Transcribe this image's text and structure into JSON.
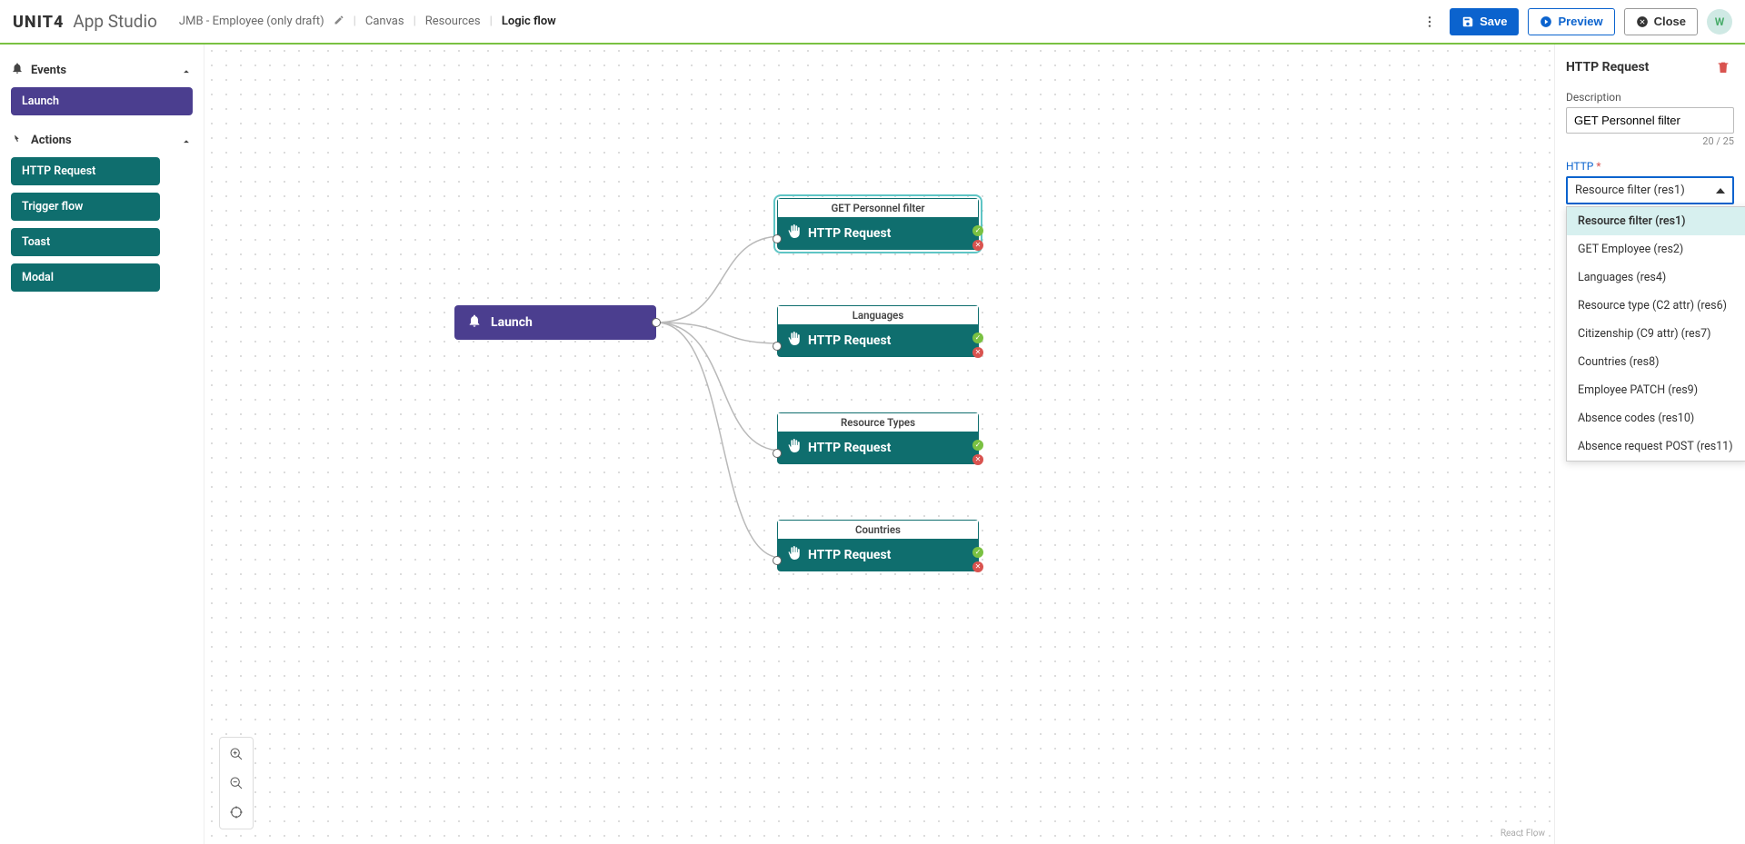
{
  "brand": {
    "logo": "UNIT4",
    "product": "App Studio"
  },
  "breadcrumbs": {
    "project": "JMB - Employee (only draft)",
    "items": [
      "Canvas",
      "Resources",
      "Logic flow"
    ],
    "active_index": 2
  },
  "top_actions": {
    "save": "Save",
    "preview": "Preview",
    "close": "Close",
    "avatar_initial": "W"
  },
  "sidebar": {
    "events_label": "Events",
    "actions_label": "Actions",
    "events": [
      {
        "label": "Launch"
      }
    ],
    "actions": [
      {
        "label": "HTTP Request"
      },
      {
        "label": "Trigger flow"
      },
      {
        "label": "Toast"
      },
      {
        "label": "Modal"
      }
    ]
  },
  "canvas": {
    "launch_label": "Launch",
    "http_label": "HTTP Request",
    "nodes": [
      {
        "title": "GET Personnel filter",
        "selected": true
      },
      {
        "title": "Languages",
        "selected": false
      },
      {
        "title": "Resource Types",
        "selected": false
      },
      {
        "title": "Countries",
        "selected": false
      }
    ],
    "attribution": "React Flow"
  },
  "rightpanel": {
    "title": "HTTP Request",
    "desc_label": "Description",
    "desc_value": "GET Personnel filter",
    "desc_counter": "20 / 25",
    "http_label": "HTTP",
    "http_selected": "Resource filter (res1)",
    "http_options": [
      "Resource filter (res1)",
      "GET Employee (res2)",
      "Languages (res4)",
      "Resource type (C2 attr) (res6)",
      "Citizenship (C9 attr) (res7)",
      "Countries (res8)",
      "Employee PATCH (res9)",
      "Absence codes (res10)",
      "Absence request POST (res11)"
    ]
  }
}
